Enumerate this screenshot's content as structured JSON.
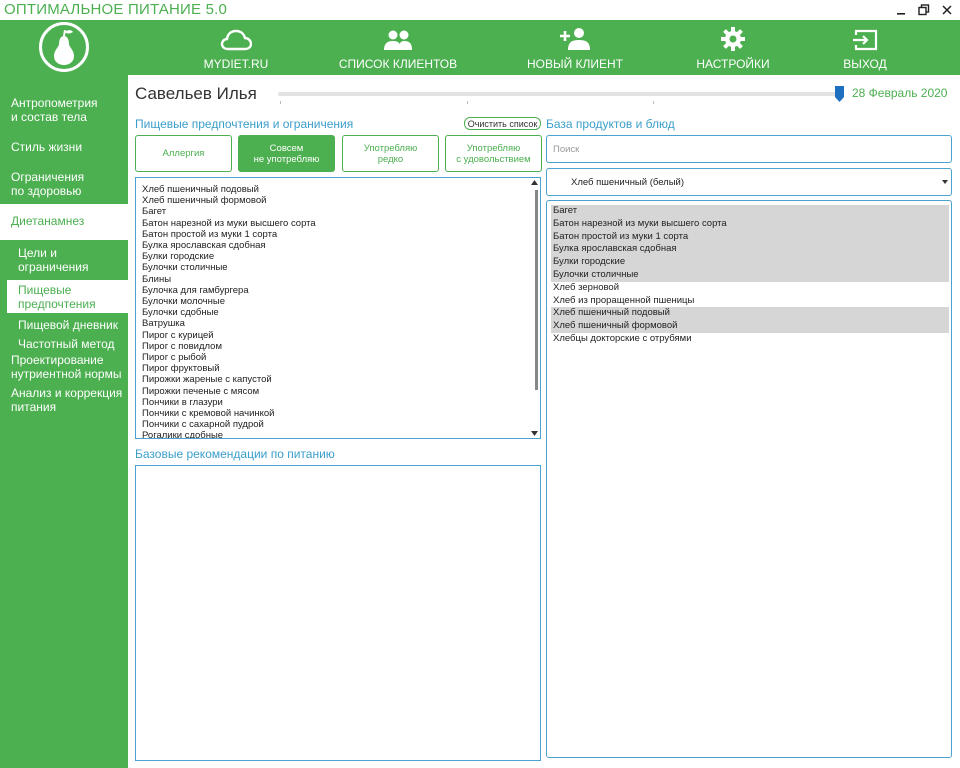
{
  "app": {
    "title": "ОПТИМАЛЬНОЕ ПИТАНИЕ 5.0"
  },
  "header": {
    "nav": [
      {
        "label": "MYDIET.RU",
        "icon": "cloud-icon"
      },
      {
        "label": "СПИСОК КЛИЕНТОВ",
        "icon": "users-icon"
      },
      {
        "label": "НОВЫЙ КЛИЕНТ",
        "icon": "add-user-icon"
      },
      {
        "label": "НАСТРОЙКИ",
        "icon": "gear-icon"
      },
      {
        "label": "ВЫХОД",
        "icon": "exit-icon"
      }
    ]
  },
  "sidebar": {
    "items": [
      {
        "label": "Антропометрия\nи состав тела"
      },
      {
        "label": "Стиль жизни"
      },
      {
        "label": "Ограничения\nпо здоровью"
      },
      {
        "label": "Диетанамнез"
      },
      {
        "label": "Проектирование\nнутриентной нормы"
      },
      {
        "label": "Анализ и коррекция\nпитания"
      }
    ],
    "subitems": [
      {
        "label": "Цели и\nограничения"
      },
      {
        "label": "Пищевые\nпредпочтения"
      },
      {
        "label": "Пищевой дневник"
      },
      {
        "label": "Частотный метод"
      }
    ]
  },
  "client": {
    "name": "Савельев Илья",
    "date": "28 Февраль 2020"
  },
  "preferences": {
    "title": "Пищевые предпочтения и ограничения",
    "clear_label": "Очистить список",
    "categories": [
      {
        "label": "Аллергия",
        "active": false
      },
      {
        "label": "Совсем\nне употребляю",
        "active": true
      },
      {
        "label": "Употребляю\nредко",
        "active": false
      },
      {
        "label": "Употребляю\nс удовольствием",
        "active": false
      }
    ],
    "items": [
      "Хлеб пшеничный подовый",
      "Хлеб пшеничный формовой",
      "Багет",
      "Батон нарезной из муки высшего сорта",
      "Батон простой из муки 1 сорта",
      "Булка ярославская сдобная",
      "Булки городские",
      "Булочки столичные",
      "Блины",
      "Булочка для гамбургера",
      "Булочки молочные",
      "Булочки сдобные",
      "Ватрушка",
      "Пирог с курицей",
      "Пирог с повидлом",
      "Пирог с рыбой",
      "Пирог фруктовый",
      "Пирожки жареные с капустой",
      "Пирожки печеные с мясом",
      "Пончики в глазури",
      "Пончики с кремовой начинкой",
      "Пончики с сахарной пудрой",
      "Рогалики сдобные"
    ]
  },
  "recommendations": {
    "title": "Базовые рекомендации по питанию"
  },
  "database": {
    "title": "База продуктов и блюд",
    "search_placeholder": "Поиск",
    "selected_group": "Хлеб пшеничный (белый)",
    "items": [
      {
        "label": "Багет",
        "highlighted": true
      },
      {
        "label": "Батон нарезной из муки высшего сорта",
        "highlighted": true
      },
      {
        "label": "Батон простой из муки 1 сорта",
        "highlighted": true
      },
      {
        "label": "Булка ярославская сдобная",
        "highlighted": true
      },
      {
        "label": "Булки городские",
        "highlighted": true
      },
      {
        "label": "Булочки столичные",
        "highlighted": true
      },
      {
        "label": "Хлеб зерновой",
        "highlighted": false
      },
      {
        "label": "Хлеб из проращенной пшеницы",
        "highlighted": false
      },
      {
        "label": "Хлеб пшеничный подовый",
        "highlighted": true
      },
      {
        "label": "Хлеб пшеничный формовой",
        "highlighted": true
      },
      {
        "label": "Хлебцы докторские с отрубями",
        "highlighted": false
      }
    ]
  },
  "colors": {
    "accent": "#4caf50",
    "section": "#3a9ecb",
    "highlight": "#d6d6d6"
  }
}
